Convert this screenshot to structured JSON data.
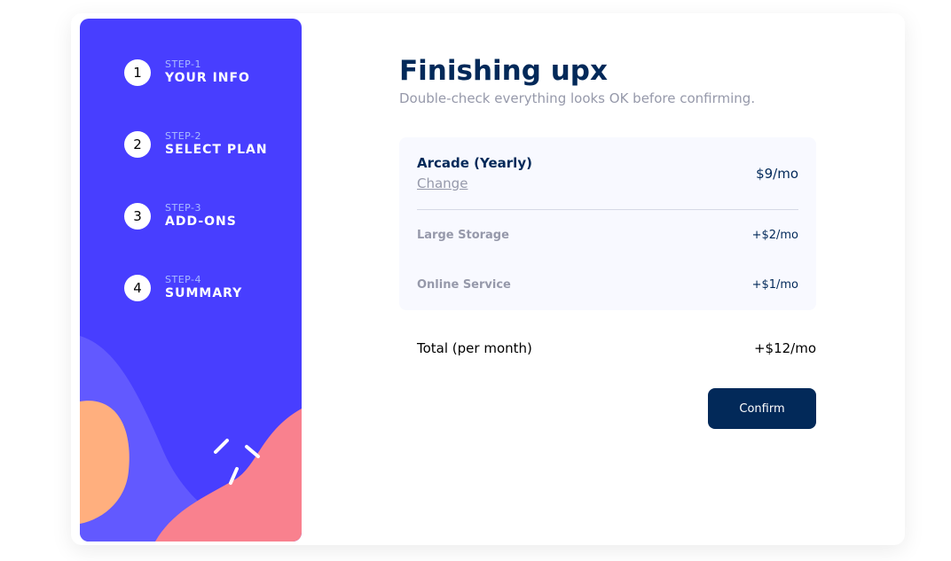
{
  "steps": [
    {
      "number": "1",
      "label": "STEP-1",
      "title": "YOUR INFO"
    },
    {
      "number": "2",
      "label": "STEP-2",
      "title": "SELECT PLAN"
    },
    {
      "number": "3",
      "label": "STEP-3",
      "title": "ADD-ONS"
    },
    {
      "number": "4",
      "label": "STEP-4",
      "title": "SUMMARY"
    }
  ],
  "main": {
    "title": "Finishing upx",
    "subtitle": "Double-check everything looks OK before confirming."
  },
  "summary": {
    "plan_name": "Arcade (Yearly)",
    "change_label": "Change",
    "plan_price": "$9/mo",
    "addons": [
      {
        "name": "Large Storage",
        "price": "+$2/mo"
      },
      {
        "name": "Online Service",
        "price": "+$1/mo"
      }
    ],
    "total_label": "Total (per month)",
    "total_price": "+$12/mo"
  },
  "actions": {
    "confirm_label": "Confirm"
  },
  "colors": {
    "sidebar_bg": "#483EFF",
    "marine_blue": "#022959",
    "cool_gray": "#9699AA",
    "alabaster": "#F8F9FF"
  }
}
